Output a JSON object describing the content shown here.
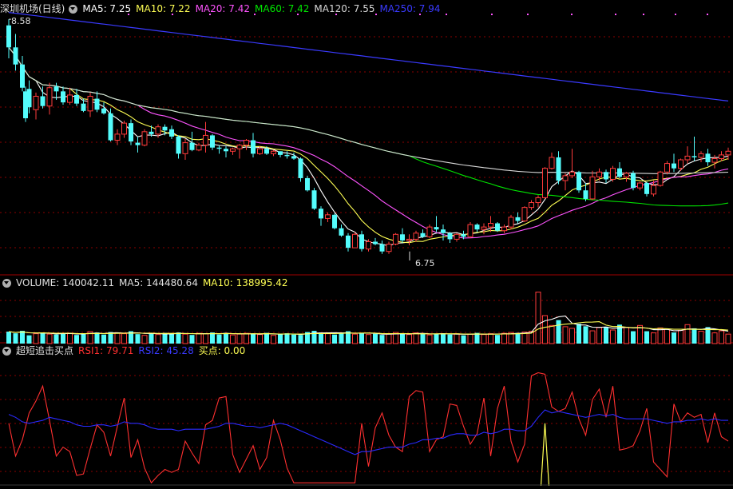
{
  "colors": {
    "up": "#ff3b3b",
    "down": "#54fcfc",
    "ma5": "#ffffff",
    "ma10": "#ffff54",
    "ma20": "#ff54ff",
    "ma60": "#00e600",
    "ma120": "#d9d9d9",
    "ma250": "#3a3aff",
    "grid": "#8b0000",
    "rsi1": "#ff3030",
    "rsi2": "#2a2aff",
    "buy": "#ffff54",
    "text": "#e0e0e0"
  },
  "price_panel": {
    "stock": "深圳机场(日线)",
    "ma5": "MA5: 7.25",
    "ma10": "MA10: 7.22",
    "ma20": "MA20: 7.42",
    "ma60": "MA60: 7.42",
    "ma120": "MA120: 7.55",
    "ma250": "MA250: 7.94",
    "high_label": "8.58",
    "low_label": "6.75"
  },
  "volume_panel": {
    "volume": "VOLUME: 140042.11",
    "ma5": "MA5: 144480.64",
    "ma10": "MA10: 138995.42"
  },
  "indicator_panel": {
    "name": "超短追击买点",
    "rsi1": "RSI1: 79.71",
    "rsi2": "RSI2: 45.28",
    "buy": "买点: 0.00"
  },
  "chart_data": {
    "type": "candlestick",
    "ylim": [
      6.6,
      8.64
    ],
    "candles": [
      [
        8.55,
        8.6,
        8.28,
        8.37
      ],
      [
        8.37,
        8.48,
        8.18,
        8.23
      ],
      [
        8.23,
        8.3,
        8.01,
        8.04
      ],
      [
        8.03,
        8.1,
        7.83,
        7.88
      ],
      [
        7.86,
        8.0,
        7.78,
        7.97
      ],
      [
        7.97,
        8.05,
        7.87,
        7.89
      ],
      [
        7.89,
        8.08,
        7.82,
        8.04
      ],
      [
        8.05,
        8.08,
        7.94,
        8.01
      ],
      [
        8.01,
        8.05,
        7.9,
        7.92
      ],
      [
        7.92,
        8.04,
        7.9,
        7.98
      ],
      [
        7.98,
        8.03,
        7.89,
        7.91
      ],
      [
        7.91,
        7.95,
        7.84,
        7.85
      ],
      [
        7.85,
        8.0,
        7.8,
        7.97
      ],
      [
        7.95,
        8.01,
        7.84,
        7.86
      ],
      [
        7.87,
        7.92,
        7.82,
        7.83
      ],
      [
        7.83,
        7.87,
        7.6,
        7.61
      ],
      [
        7.61,
        7.7,
        7.57,
        7.66
      ],
      [
        7.66,
        7.77,
        7.63,
        7.75
      ],
      [
        7.75,
        7.78,
        7.57,
        7.6
      ],
      [
        7.59,
        7.64,
        7.51,
        7.57
      ],
      [
        7.57,
        7.7,
        7.56,
        7.68
      ],
      [
        7.68,
        7.73,
        7.64,
        7.66
      ],
      [
        7.66,
        7.74,
        7.63,
        7.72
      ],
      [
        7.72,
        7.74,
        7.65,
        7.69
      ],
      [
        7.7,
        7.73,
        7.62,
        7.64
      ],
      [
        7.64,
        7.65,
        7.46,
        7.5
      ],
      [
        7.5,
        7.62,
        7.45,
        7.59
      ],
      [
        7.59,
        7.68,
        7.52,
        7.53
      ],
      [
        7.53,
        7.59,
        7.52,
        7.57
      ],
      [
        7.57,
        7.76,
        7.51,
        7.65
      ],
      [
        7.65,
        7.66,
        7.53,
        7.55
      ],
      [
        7.55,
        7.57,
        7.5,
        7.54
      ],
      [
        7.54,
        7.56,
        7.47,
        7.52
      ],
      [
        7.52,
        7.55,
        7.49,
        7.54
      ],
      [
        7.54,
        7.58,
        7.46,
        7.57
      ],
      [
        7.57,
        7.62,
        7.53,
        7.61
      ],
      [
        7.61,
        7.67,
        7.47,
        7.5
      ],
      [
        7.5,
        7.56,
        7.49,
        7.54
      ],
      [
        7.54,
        7.56,
        7.49,
        7.5
      ],
      [
        7.5,
        7.53,
        7.48,
        7.52
      ],
      [
        7.52,
        7.52,
        7.47,
        7.49
      ],
      [
        7.49,
        7.52,
        7.46,
        7.48
      ],
      [
        7.48,
        7.51,
        7.45,
        7.46
      ],
      [
        7.46,
        7.47,
        7.27,
        7.3
      ],
      [
        7.3,
        7.32,
        7.19,
        7.2
      ],
      [
        7.2,
        7.22,
        7.04,
        7.05
      ],
      [
        7.05,
        7.07,
        6.91,
        6.97
      ],
      [
        6.97,
        7.02,
        6.94,
        7.0
      ],
      [
        7.0,
        7.01,
        6.88,
        6.89
      ],
      [
        6.89,
        6.92,
        6.82,
        6.83
      ],
      [
        6.83,
        6.85,
        6.7,
        6.73
      ],
      [
        6.73,
        6.86,
        6.74,
        6.84
      ],
      [
        6.84,
        6.87,
        6.7,
        6.72
      ],
      [
        6.72,
        6.8,
        6.7,
        6.78
      ],
      [
        6.78,
        6.81,
        6.75,
        6.76
      ],
      [
        6.76,
        6.79,
        6.68,
        6.7
      ],
      [
        6.7,
        6.78,
        6.68,
        6.76
      ],
      [
        6.76,
        6.85,
        6.75,
        6.84
      ],
      [
        6.84,
        6.89,
        6.77,
        6.79
      ],
      [
        6.79,
        6.84,
        6.75,
        6.8
      ],
      [
        6.8,
        6.87,
        6.78,
        6.85
      ],
      [
        6.85,
        6.88,
        6.81,
        6.82
      ],
      [
        6.82,
        6.92,
        6.81,
        6.9
      ],
      [
        6.9,
        6.99,
        6.86,
        6.88
      ],
      [
        6.88,
        6.92,
        6.79,
        6.85
      ],
      [
        6.85,
        6.86,
        6.77,
        6.8
      ],
      [
        6.8,
        6.85,
        6.78,
        6.84
      ],
      [
        6.84,
        6.87,
        6.8,
        6.82
      ],
      [
        6.82,
        6.94,
        6.81,
        6.92
      ],
      [
        6.92,
        6.93,
        6.86,
        6.88
      ],
      [
        6.88,
        6.93,
        6.84,
        6.9
      ],
      [
        6.9,
        6.99,
        6.86,
        6.93
      ],
      [
        6.93,
        6.94,
        6.86,
        6.87
      ],
      [
        6.87,
        6.92,
        6.85,
        6.9
      ],
      [
        6.9,
        7.0,
        6.88,
        6.98
      ],
      [
        6.98,
        7.02,
        6.93,
        6.95
      ],
      [
        6.95,
        7.07,
        6.94,
        7.06
      ],
      [
        7.06,
        7.12,
        7.04,
        7.1
      ],
      [
        7.1,
        7.16,
        7.06,
        7.14
      ],
      [
        7.14,
        7.39,
        7.13,
        7.38
      ],
      [
        7.38,
        7.51,
        7.37,
        7.47
      ],
      [
        7.47,
        7.52,
        7.25,
        7.28
      ],
      [
        7.28,
        7.34,
        7.2,
        7.32
      ],
      [
        7.32,
        7.54,
        7.3,
        7.35
      ],
      [
        7.35,
        7.36,
        7.18,
        7.2
      ],
      [
        7.2,
        7.26,
        7.11,
        7.13
      ],
      [
        7.13,
        7.36,
        7.12,
        7.31
      ],
      [
        7.31,
        7.38,
        7.28,
        7.35
      ],
      [
        7.35,
        7.37,
        7.26,
        7.29
      ],
      [
        7.29,
        7.4,
        7.27,
        7.38
      ],
      [
        7.38,
        7.43,
        7.3,
        7.31
      ],
      [
        7.31,
        7.35,
        7.27,
        7.34
      ],
      [
        7.34,
        7.36,
        7.2,
        7.22
      ],
      [
        7.22,
        7.27,
        7.2,
        7.26
      ],
      [
        7.26,
        7.27,
        7.15,
        7.17
      ],
      [
        7.17,
        7.28,
        7.15,
        7.24
      ],
      [
        7.24,
        7.36,
        7.23,
        7.35
      ],
      [
        7.35,
        7.44,
        7.33,
        7.42
      ],
      [
        7.42,
        7.5,
        7.35,
        7.38
      ],
      [
        7.38,
        7.46,
        7.36,
        7.45
      ],
      [
        7.45,
        7.56,
        7.42,
        7.48
      ],
      [
        7.48,
        7.64,
        7.44,
        7.47
      ],
      [
        7.47,
        7.52,
        7.43,
        7.5
      ],
      [
        7.5,
        7.54,
        7.4,
        7.43
      ],
      [
        7.43,
        7.49,
        7.38,
        7.46
      ],
      [
        7.46,
        7.52,
        7.44,
        7.49
      ],
      [
        7.49,
        7.55,
        7.45,
        7.52
      ]
    ],
    "extra_candle": [
      8.01,
      8.05,
      7.76,
      7.79
    ],
    "ma_periods": [
      5,
      10,
      20,
      60,
      120,
      250
    ],
    "ma250_path": [
      [
        8.66,
        8.62
      ],
      [
        7.93,
        7.94
      ]
    ],
    "volume": [
      29,
      25,
      31,
      20,
      24,
      27,
      23,
      22,
      26,
      25,
      21,
      23,
      29,
      27,
      22,
      28,
      26,
      24,
      30,
      23,
      20,
      25,
      22,
      26,
      24,
      27,
      23,
      21,
      25,
      24,
      27,
      22,
      26,
      21,
      23,
      25,
      24,
      22,
      26,
      20,
      23,
      25,
      22,
      21,
      28,
      31,
      27,
      24,
      22,
      26,
      30,
      23,
      25,
      22,
      24,
      21,
      23,
      27,
      24,
      22,
      26,
      25,
      21,
      23,
      25,
      22,
      24,
      20,
      23,
      26,
      22,
      24,
      21,
      25,
      27,
      26,
      28,
      30,
      125,
      68,
      44,
      57,
      41,
      37,
      48,
      42,
      31,
      39,
      41,
      33,
      46,
      39,
      30,
      44,
      30,
      26,
      38,
      35,
      27,
      32,
      46,
      37,
      30,
      40,
      26,
      31,
      23
    ],
    "vol_ylim": [
      0,
      132
    ],
    "rsi1": [
      40,
      18,
      29,
      47,
      55,
      65,
      42,
      18,
      24,
      21,
      5,
      6,
      23,
      39,
      34,
      18,
      38,
      57,
      17,
      29,
      10,
      0,
      5,
      9,
      7,
      9,
      28,
      20,
      13,
      39,
      42,
      57,
      58,
      19,
      7,
      16,
      25,
      9,
      17,
      42,
      29,
      10,
      0,
      0,
      0,
      0,
      0,
      0,
      0,
      0,
      0,
      0,
      40,
      11,
      37,
      47,
      32,
      24,
      21,
      58,
      62,
      61,
      21,
      29,
      31,
      53,
      52,
      38,
      26,
      33,
      57,
      18,
      50,
      65,
      28,
      14,
      26,
      72,
      74,
      73,
      51,
      48,
      50,
      61,
      43,
      32,
      56,
      63,
      44,
      65,
      22,
      23,
      25,
      35,
      50,
      14,
      9,
      4,
      53,
      41,
      47,
      44,
      46,
      27,
      47,
      31,
      28
    ],
    "rsi2": [
      46,
      44,
      41,
      40,
      41,
      42,
      44,
      43,
      42,
      41,
      39,
      38,
      38,
      39,
      39,
      38,
      39,
      41,
      40,
      40,
      39,
      37,
      36,
      36,
      36,
      35,
      36,
      36,
      36,
      36,
      37,
      38,
      40,
      40,
      39,
      38,
      38,
      37,
      38,
      39,
      40,
      39,
      37,
      35,
      33,
      31,
      29,
      27,
      25,
      23,
      21,
      19,
      21,
      21,
      22,
      23,
      24,
      24,
      24,
      26,
      27,
      29,
      29,
      30,
      30,
      32,
      33,
      33,
      32,
      32,
      34,
      33,
      34,
      36,
      36,
      35,
      35,
      38,
      44,
      49,
      47,
      48,
      47,
      46,
      45,
      44,
      45,
      46,
      45,
      46,
      44,
      43,
      43,
      43,
      43,
      42,
      41,
      40,
      41,
      41,
      42,
      42,
      43,
      42,
      43,
      42,
      42
    ],
    "rsi_ylim": [
      -2,
      85
    ],
    "buy_points": [
      {
        "index": 79,
        "value": 40
      }
    ]
  }
}
